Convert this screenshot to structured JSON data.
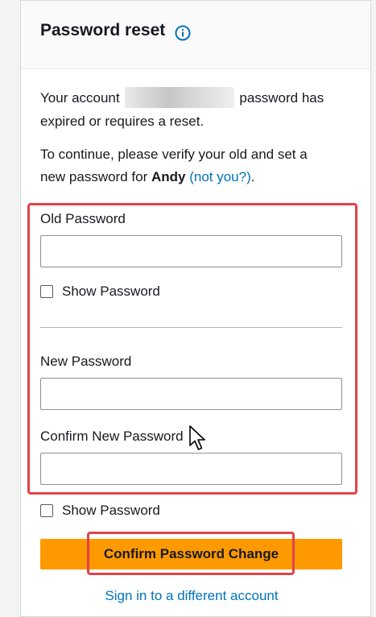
{
  "header": {
    "title": "Password reset",
    "info_icon": "info-circle-icon"
  },
  "intro": {
    "line1_prefix": "Your account",
    "line1_suffix": "password has",
    "line2": "expired or requires a reset.",
    "line3": "To continue, please verify your old and set a",
    "line4_prefix": "new password for",
    "username": "Andy",
    "not_you_link": "(not you?)",
    "line4_suffix": "."
  },
  "form": {
    "old_password_label": "Old Password",
    "old_password_value": "",
    "show_password_label_1": "Show Password",
    "new_password_label": "New Password",
    "new_password_value": "",
    "confirm_password_label": "Confirm New Password",
    "confirm_password_value": "",
    "show_password_label_2": "Show Password"
  },
  "actions": {
    "confirm_button_label": "Confirm Password Change",
    "sign_in_link": "Sign in to a different account"
  },
  "colors": {
    "accent_button": "#ff9900",
    "link": "#0073bb",
    "annotation_outline": "#e0434a"
  },
  "icons": {
    "cursor": "mouse-pointer-icon"
  }
}
